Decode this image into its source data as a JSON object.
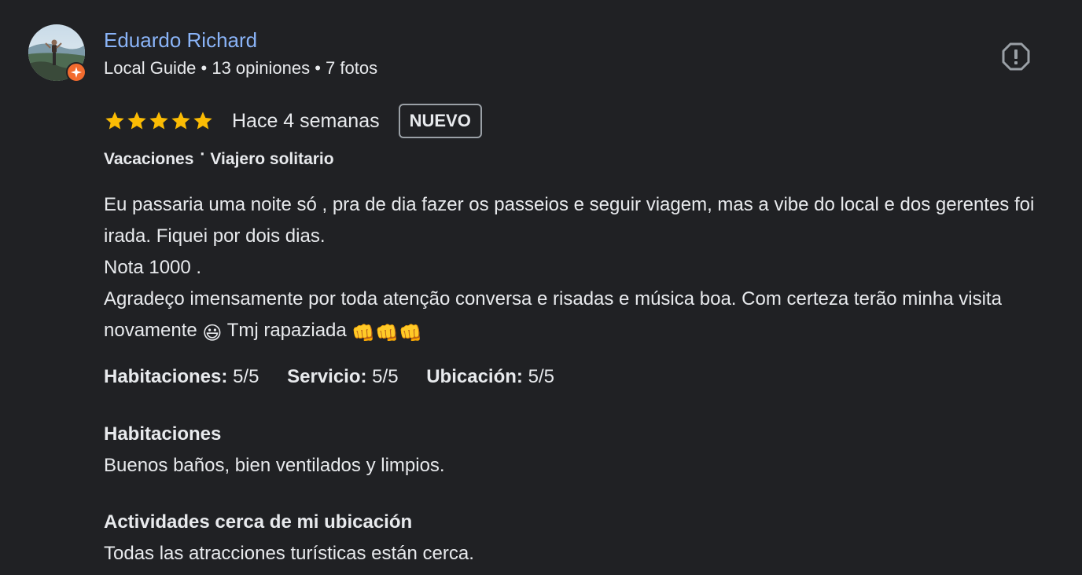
{
  "author": {
    "name": "Eduardo Richard",
    "meta": "Local Guide • 13 opiniones • 7 fotos",
    "avatar_icon": "profile-photo",
    "badge_icon": "local-guide-badge-icon",
    "badge_color": "#f26b2e"
  },
  "review": {
    "rating": 5,
    "rating_max": 5,
    "star_color": "#fbbc04",
    "date": "Hace 4 semanas",
    "badge": "NUEVO",
    "trip_type": "Vacaciones",
    "trip_separator": "·",
    "travel_group": "Viajero solitario",
    "text_lines": [
      "Eu passaria uma noite só , pra de dia fazer os passeios e seguir viagem, mas a vibe do local e dos gerentes foi irada. Fiquei por dois dias.",
      "Nota 1000 .",
      "Agradeço imensamente por toda atenção conversa e risadas e música boa. Com certeza terão minha visita novamente"
    ],
    "text_tail": "Tmj rapaziada",
    "emoji_smile": "😃",
    "emoji_fists": "👊👊👊"
  },
  "sub_ratings": [
    {
      "label": "Habitaciones",
      "value": "5/5"
    },
    {
      "label": "Servicio",
      "value": "5/5"
    },
    {
      "label": "Ubicación",
      "value": "5/5"
    }
  ],
  "sections": [
    {
      "heading": "Habitaciones",
      "body": "Buenos baños, bien ventilados y limpios."
    },
    {
      "heading": "Actividades cerca de mi ubicación",
      "body": "Todas las atracciones turísticas están cerca."
    }
  ],
  "actions": {
    "report_icon": "report-icon"
  },
  "colors": {
    "background": "#202124",
    "link": "#8ab4f8",
    "text": "#e8eaed"
  }
}
